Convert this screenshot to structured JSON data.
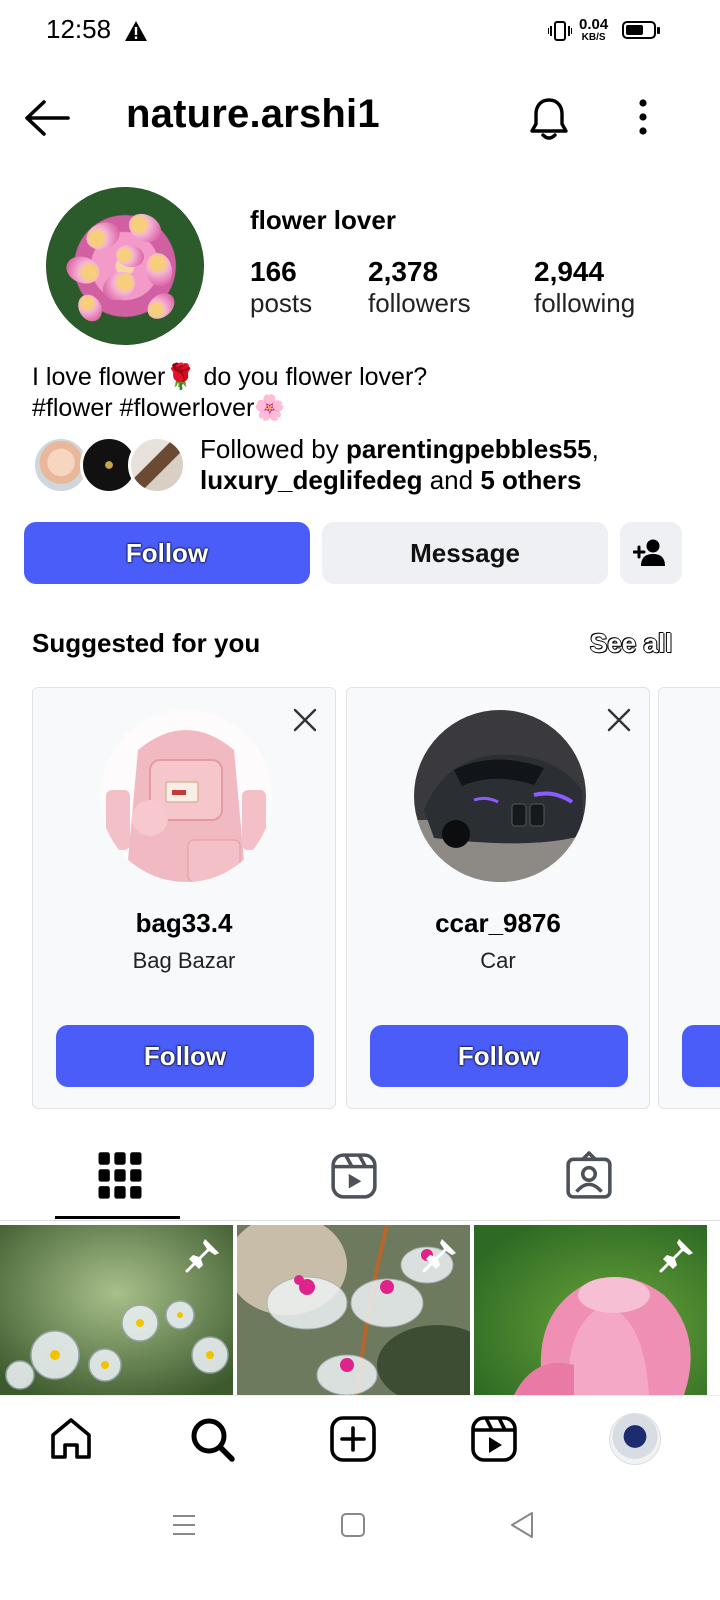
{
  "status": {
    "time": "12:58",
    "net_speed": "0.04",
    "net_unit": "KB/S",
    "battery_level": 0.65
  },
  "header": {
    "username": "nature.arshi1"
  },
  "profile": {
    "display_name": "flower lover",
    "stats": [
      {
        "value": "166",
        "label": "posts"
      },
      {
        "value": "2,378",
        "label": "followers"
      },
      {
        "value": "2,944",
        "label": "following"
      }
    ],
    "bio_line1": "I love flower🌹 do you flower lover?",
    "bio_line2": "#flower #flowerlover🌸",
    "followed_by_prefix": "Followed by ",
    "followed_by_user1": "parentingpebbles55",
    "followed_by_sep": ",",
    "followed_by_user2": "luxury_deglifedeg",
    "followed_by_and": " and ",
    "followed_by_others": "5 others"
  },
  "actions": {
    "follow": "Follow",
    "message": "Message"
  },
  "suggestions": {
    "title": "Suggested for you",
    "see_all": "See all",
    "cards": [
      {
        "username": "bag33.4",
        "subtitle": "Bag Bazar",
        "button": "Follow"
      },
      {
        "username": "ccar_9876",
        "subtitle": "Car",
        "button": "Follow"
      }
    ]
  },
  "tabs": [
    "grid-icon",
    "reels-icon",
    "tagged-icon"
  ],
  "nav": [
    "home-icon",
    "search-icon",
    "create-icon",
    "reels-icon",
    "profile-avatar"
  ],
  "colors": {
    "accent": "#4a5df9",
    "secondary_button": "#eff0f4"
  }
}
